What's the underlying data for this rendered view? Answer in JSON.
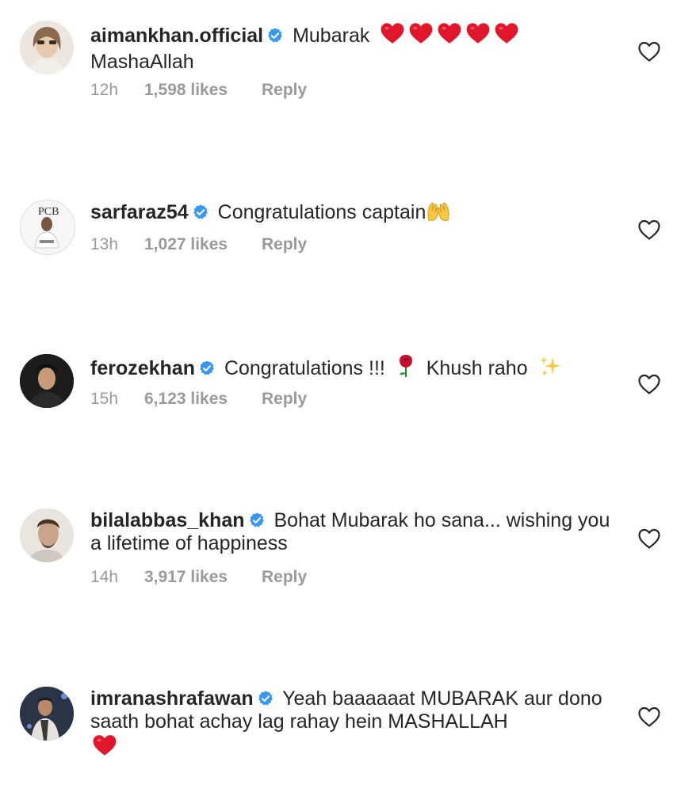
{
  "comments": [
    {
      "username": "aimankhan.official",
      "text_line1": "Mubarak",
      "text_line2": "MashaAllah",
      "emoji": "❤❤❤❤❤",
      "time": "12h",
      "likes": "1,598 likes",
      "reply": "Reply"
    },
    {
      "username": "sarfaraz54",
      "text": "Congratulations captain",
      "emoji": "🙌",
      "time": "13h",
      "likes": "1,027 likes",
      "reply": "Reply"
    },
    {
      "username": "ferozekhan",
      "text": "Congratulations !!!",
      "emoji_rose": "🌹",
      "text2": "Khush raho",
      "emoji_sparkles": "✨",
      "time": "15h",
      "likes": "6,123 likes",
      "reply": "Reply"
    },
    {
      "username": "bilalabbas_khan",
      "text": "Bohat Mubarak ho sana... wishing you a lifetime of happiness",
      "time": "14h",
      "likes": "3,917 likes",
      "reply": "Reply"
    },
    {
      "username": "imranashrafawan",
      "text": "Yeah baaaaaat MUBARAK aur dono saath bohat achay lag rahay hein MASHALLAH",
      "emoji": "❤",
      "time": "",
      "likes": "",
      "reply": ""
    }
  ],
  "icons": {
    "verified": "verified-badge-icon",
    "like": "heart-outline-icon"
  },
  "colors": {
    "verified_blue": "#3897f0",
    "heart_red": "#e0162b",
    "meta_gray": "#9a9a9a",
    "text": "#262626"
  }
}
